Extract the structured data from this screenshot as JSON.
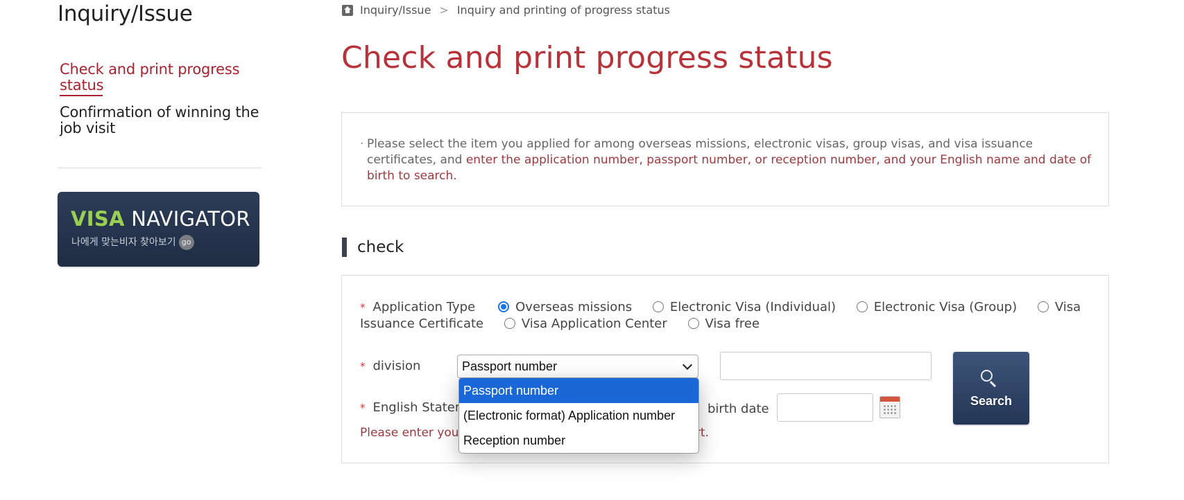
{
  "sidebar": {
    "title": "Inquiry/Issue",
    "items": [
      {
        "label": "Check and print progress status",
        "active": true
      },
      {
        "label": "Confirmation of winning the job visit",
        "active": false
      }
    ],
    "banner": {
      "highlight": "VISA",
      "title_rest": " NAVIGATOR",
      "subtitle": "나에게 맞는비자 찾아보기",
      "go_label": "go"
    }
  },
  "breadcrumb": {
    "home_icon": "home-icon",
    "items": [
      "Inquiry/Issue",
      "Inquiry and printing of progress status"
    ],
    "separator": ">"
  },
  "page": {
    "title": "Check and print progress status",
    "info": {
      "bullet": "·",
      "part1": "Please select the item you applied for among overseas missions, electronic visas, group visas, and visa issuance certificates, and ",
      "part2": "enter the application number, passport number, or reception number, and your English name and date of birth to search."
    },
    "section_heading": "check"
  },
  "form": {
    "application_type": {
      "label": "Application Type",
      "options": [
        {
          "label": "Overseas missions",
          "checked": true
        },
        {
          "label": "Electronic Visa (Individual)",
          "checked": false
        },
        {
          "label": "Electronic Visa (Group)",
          "checked": false
        },
        {
          "label": "Visa Issuance Certificate",
          "checked": false
        },
        {
          "label": "Visa Application Center",
          "checked": false
        },
        {
          "label": "Visa free",
          "checked": false
        }
      ]
    },
    "division": {
      "label": "division",
      "selected": "Passport number",
      "options": [
        "Passport number",
        "(Electronic format) Application number",
        "Reception number"
      ],
      "number_value": ""
    },
    "english_name": {
      "label": "English Statement"
    },
    "birth_date": {
      "label": "birth date",
      "value": ""
    },
    "warning": "Please enter your English name as stated in your passport.",
    "search_label": "Search",
    "required_mark": "*"
  },
  "colors": {
    "accent_red": "#b8323a",
    "nav_active": "#a8232f",
    "dropdown_highlight": "#1a68d8",
    "search_button": "#2f4568"
  }
}
